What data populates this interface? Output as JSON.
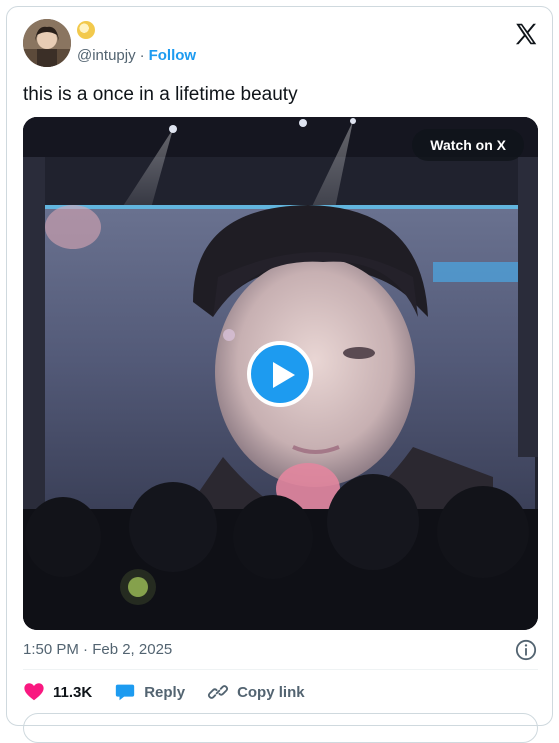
{
  "author": {
    "handle": "@intupjy",
    "separator": "·",
    "follow_label": "Follow"
  },
  "post": {
    "text": "this is a once in a lifetime beauty"
  },
  "media": {
    "watch_label": "Watch on X"
  },
  "meta": {
    "timestamp": "1:50 PM · Feb 2, 2025"
  },
  "actions": {
    "likes": "11.3K",
    "reply_label": "Reply",
    "copy_label": "Copy link"
  },
  "colors": {
    "accent": "#1d9bf0",
    "like": "#f91880",
    "text_secondary": "#536471"
  }
}
